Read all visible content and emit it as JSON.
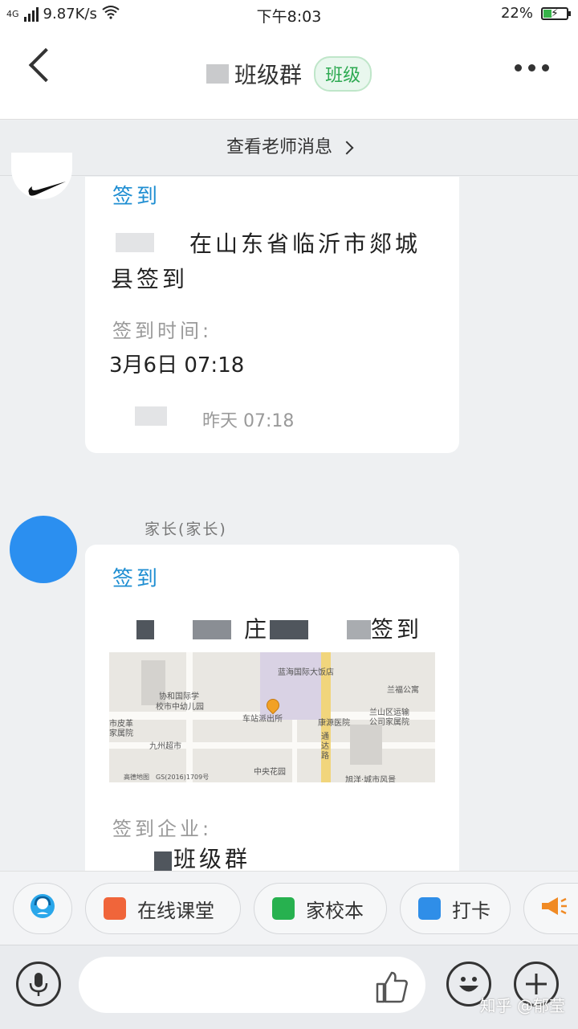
{
  "status_bar": {
    "network": "4G",
    "speed": "9.87K/s",
    "time": "下午8:03",
    "battery": "22%"
  },
  "header": {
    "title": "班级群",
    "tag": "班级"
  },
  "teacher_bar": {
    "label": "查看老师消息"
  },
  "messages": [
    {
      "type_label": "签到",
      "location_text_line1": "在山东省临沂市郯城",
      "location_text_line2": "县签到",
      "time_label": "签到时间:",
      "time_value": "3月6日 07:18",
      "meta": "昨天 07:18"
    },
    {
      "sender": "家长(家长)",
      "type_label": "签到",
      "location_fragment_1": "庄",
      "location_fragment_2": "签到",
      "map_labels": [
        "蓝海国际大饭店",
        "兰福公寓",
        "协和国际学",
        "校市中幼儿园",
        "车站派出所",
        "康源医院",
        "兰山区运输",
        "公司家属院",
        "市皮革",
        "家属院",
        "九州超市",
        "通",
        "达",
        "路",
        "中央花园",
        "旭洋·城市风景",
        "高德地图",
        "GS(2016)1709号"
      ],
      "company_label": "签到企业:",
      "company_value": "班级群"
    }
  ],
  "toolbar": {
    "items": [
      "在线课堂",
      "家校本",
      "打卡"
    ],
    "colors": {
      "classroom": "#f0653a",
      "homework": "#27b14f",
      "checkin": "#2f8ee8",
      "notice": "#f08a24",
      "headset": "#2aa7ea"
    }
  },
  "watermark": "知乎 @郁莹"
}
